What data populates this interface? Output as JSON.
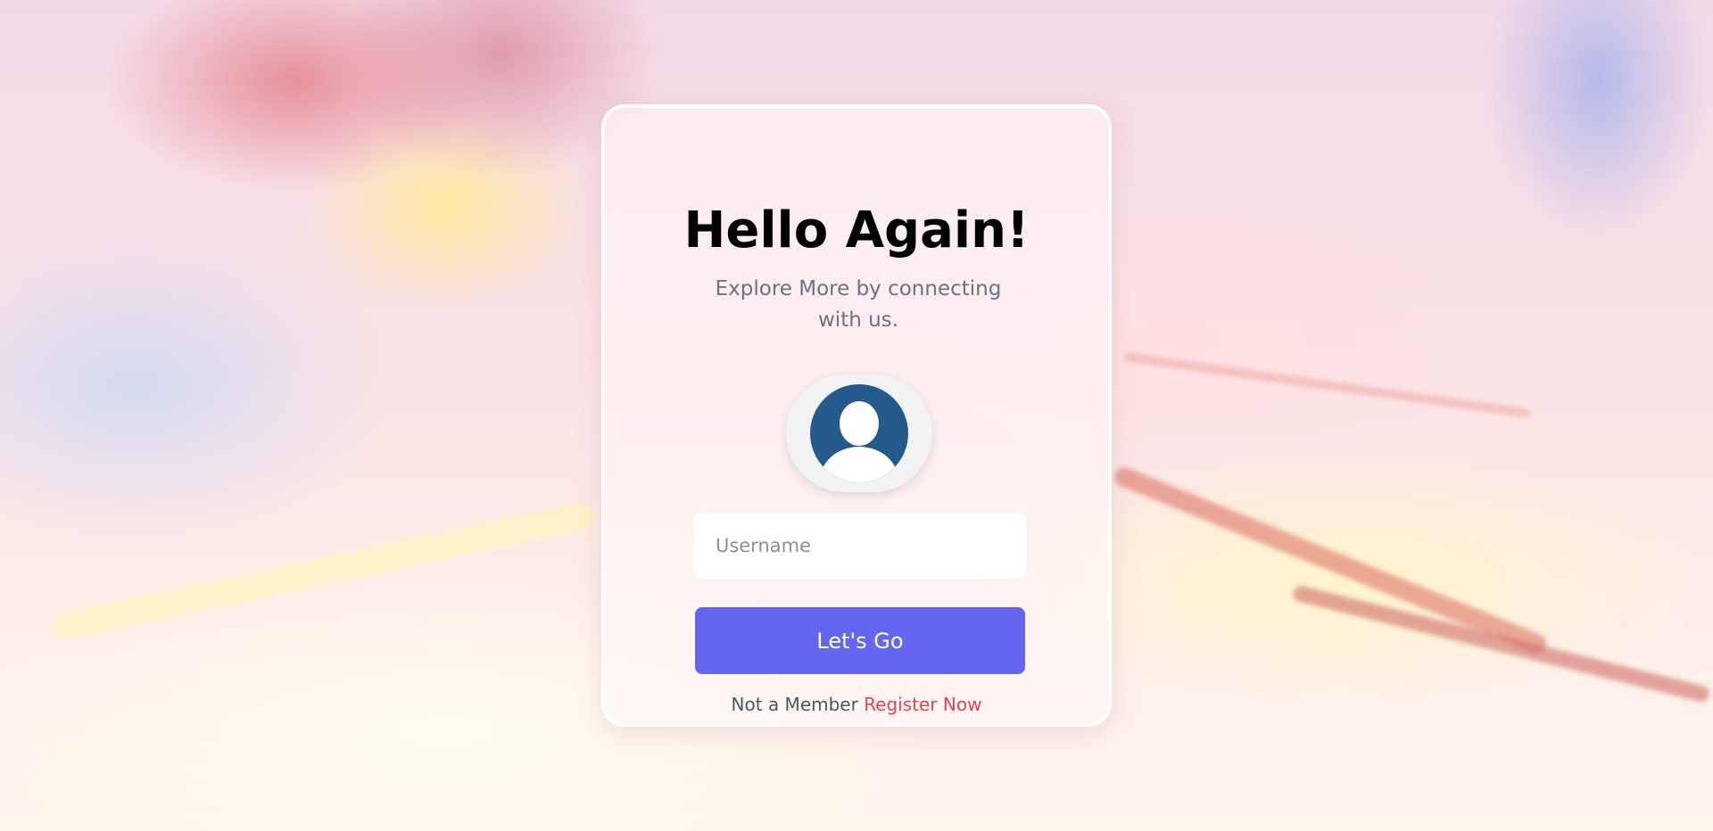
{
  "login": {
    "title": "Hello Again!",
    "subtitle": "Explore More by connecting with us.",
    "username_placeholder": "Username",
    "username_value": "",
    "submit_label": "Let's Go",
    "footer_text": "Not a Member",
    "register_link": "Register Now"
  },
  "icons": {
    "avatar": "user-avatar-icon"
  },
  "colors": {
    "button": "#6366f1",
    "link": "#e0444c",
    "avatar": "#245b8c"
  }
}
